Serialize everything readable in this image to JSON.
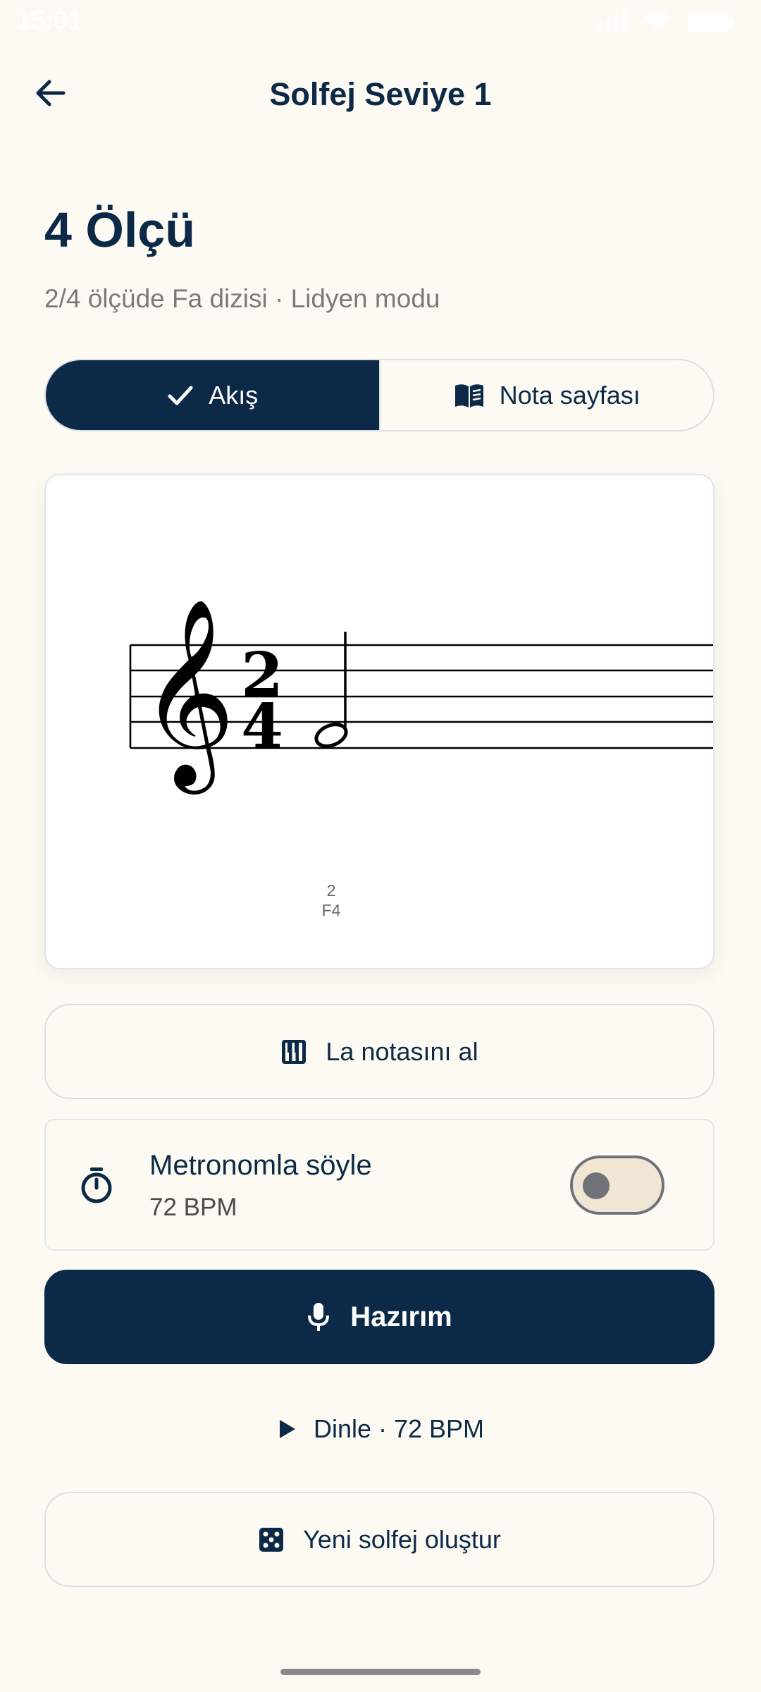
{
  "status_bar": {
    "time": "15:01"
  },
  "app_bar": {
    "title": "Solfej Seviye 1",
    "back_icon": "arrow-left-icon"
  },
  "heading": {
    "title": "4 Ölçü",
    "subtitle": "2/4 ölçüde Fa dizisi · Lidyen modu"
  },
  "view_toggle": {
    "options": [
      {
        "label": "Akış",
        "icon": "check-icon",
        "selected": true
      },
      {
        "label": "Nota sayfası",
        "icon": "book-open-icon",
        "selected": false
      }
    ]
  },
  "score": {
    "clef": "treble-clef",
    "time_signature": {
      "top": "2",
      "bottom": "4"
    },
    "notes": [
      {
        "beat_label": "2",
        "pitch": "F4",
        "duration": "half"
      }
    ]
  },
  "reference_button": {
    "label": "La notasını al",
    "icon": "piano-icon"
  },
  "metronome": {
    "title": "Metronomla söyle",
    "bpm_text": "72 BPM",
    "icon": "timer-icon",
    "enabled": false
  },
  "ready_button": {
    "label": "Hazırım",
    "icon": "microphone-icon"
  },
  "listen_button": {
    "label": "Dinle · 72 BPM",
    "icon": "play-icon"
  },
  "new_button": {
    "label": "Yeni solfej oluştur",
    "icon": "dice-icon"
  },
  "colors": {
    "primary": "#0c2a47",
    "background": "#fdfaf3",
    "muted": "#7a7a7a",
    "toggle_track": "#f1e6d4"
  }
}
